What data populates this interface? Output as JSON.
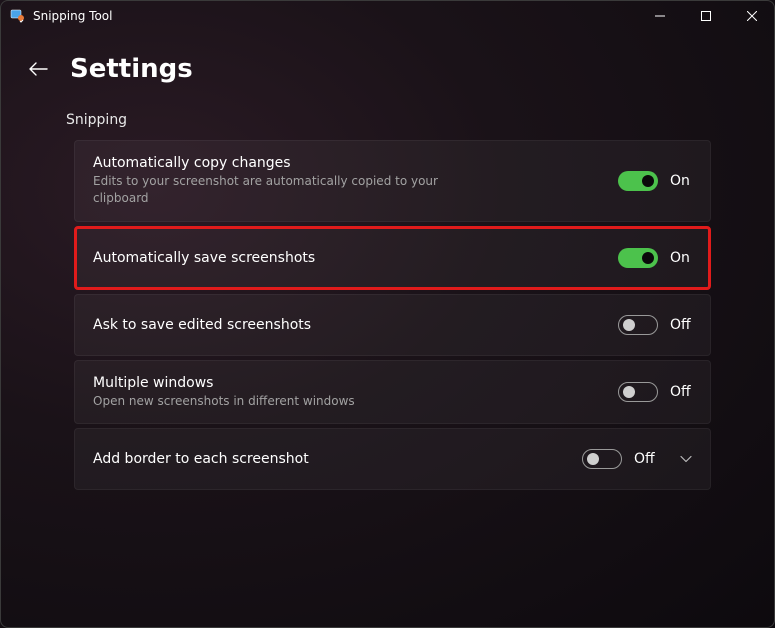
{
  "window": {
    "app_title": "Snipping Tool"
  },
  "header": {
    "title": "Settings"
  },
  "section": {
    "label": "Snipping"
  },
  "settings": [
    {
      "title": "Automatically copy changes",
      "subtitle": "Edits to your screenshot are automatically copied to your clipboard",
      "state": "On",
      "on": true,
      "highlighted": false,
      "expandable": false
    },
    {
      "title": "Automatically save screenshots",
      "subtitle": "",
      "state": "On",
      "on": true,
      "highlighted": true,
      "expandable": false
    },
    {
      "title": "Ask to save edited screenshots",
      "subtitle": "",
      "state": "Off",
      "on": false,
      "highlighted": false,
      "expandable": false
    },
    {
      "title": "Multiple windows",
      "subtitle": "Open new screenshots in different windows",
      "state": "Off",
      "on": false,
      "highlighted": false,
      "expandable": false
    },
    {
      "title": "Add border to each screenshot",
      "subtitle": "",
      "state": "Off",
      "on": false,
      "highlighted": false,
      "expandable": true
    }
  ]
}
